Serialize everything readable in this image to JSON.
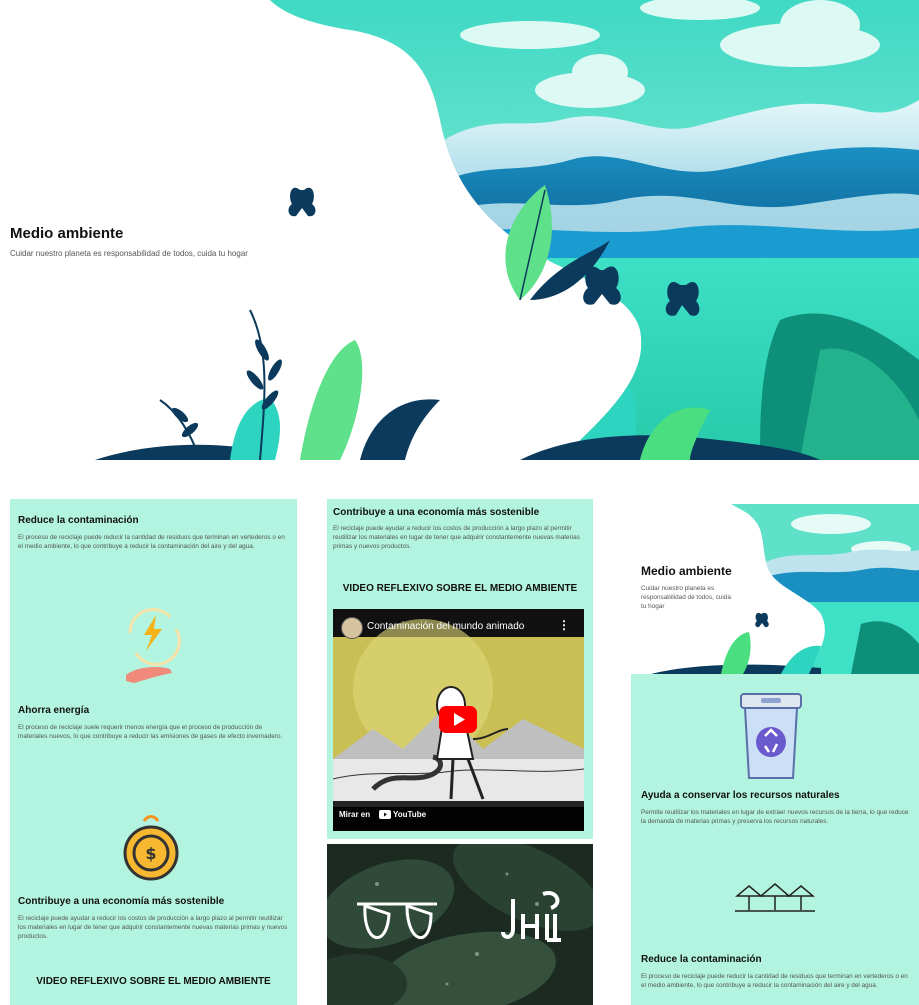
{
  "hero": {
    "title": "Medio ambiente",
    "subtitle": "Cuidar nuestro planeta es responsabilidad de todos, cuida tu hogar"
  },
  "col1": {
    "s1_title": "Reduce la contaminación",
    "s1_text": "El proceso de reciclaje puede reducir la cantidad de residuos que terminan en vertederos o en el medio ambiente, lo que contribuye a reducir la contaminación del aire y del agua.",
    "s2_title": "Ahorra energía",
    "s2_text": "El proceso de reciclaje suele requerir menos energía que el proceso de producción de materiales nuevos, lo que contribuye a reducir las emisiones de gases de efecto invernadero.",
    "s3_title": "Contribuye a una economía más sostenible",
    "s3_text": "El reciclaje puede ayudar a reducir los costos de producción a largo plazo al permitir reutilizar los materiales en lugar de tener que adquirir constantemente nuevas materias primas y nuevos productos.",
    "video_heading": "VIDEO REFLEXIVO SOBRE EL MEDIO AMBIENTE"
  },
  "col2": {
    "s1_title": "Contribuye a una economía más sostenible",
    "s1_text": "El reciclaje puede ayudar a reducir los costos de producción a largo plazo al permitir reutilizar los materiales en lugar de tener que adquirir constantemente nuevas materias primas y nuevos productos.",
    "video_heading": "VIDEO REFLEXIVO SOBRE EL MEDIO AMBIENTE",
    "video": {
      "title": "Contaminación del mundo animado",
      "watch_on": "Mirar en",
      "platform": "YouTube"
    }
  },
  "col3": {
    "hero_title": "Medio ambiente",
    "hero_sub": "Cuidar nuestro planeta es responsabilidad de todos, cuida tu hogar",
    "s1_title": "Ayuda a conservar los recursos naturales",
    "s1_text": "Permite reutilizar los materiales en lugar de extraer nuevos recursos de la tierra, lo que reduce la demanda de materias primas y preserva los recursos naturales.",
    "s2_title": "Reduce la contaminación",
    "s2_text": "El proceso de reciclaje puede reducir la cantidad de residuos que terminan en vertederos o en el medio ambiente, lo que contribuye a reducir la contaminación del aire y del agua."
  },
  "colors": {
    "panel": "#b2f4df",
    "teal": "#2dd4bf",
    "navy": "#0b3a5c",
    "green": "#4ade80"
  },
  "icons": [
    "energy-hand-icon",
    "coin-piggy-icon",
    "recycle-bin-icon",
    "trees-icon",
    "butterfly-icon",
    "play-icon"
  ]
}
